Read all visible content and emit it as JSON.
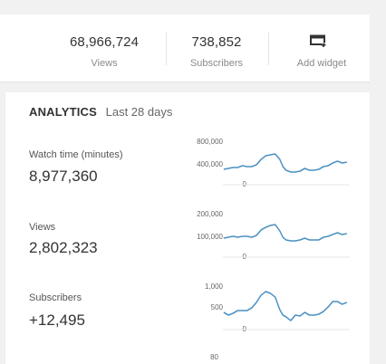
{
  "stats": {
    "views_value": "68,966,724",
    "views_label": "Views",
    "subscribers_value": "738,852",
    "subscribers_label": "Subscribers",
    "add_widget_label": "Add widget"
  },
  "analytics": {
    "title": "ANALYTICS",
    "period": "Last 28 days",
    "metrics": [
      {
        "label": "Watch time (minutes)",
        "value": "8,977,360",
        "ticks": [
          "800,000",
          "400,000",
          "0"
        ]
      },
      {
        "label": "Views",
        "value": "2,802,323",
        "ticks": [
          "200,000",
          "100,000",
          "0"
        ]
      },
      {
        "label": "Subscribers",
        "value": "+12,495",
        "ticks": [
          "1,000",
          "500",
          "0"
        ]
      },
      {
        "ticks": [
          "80"
        ]
      }
    ]
  },
  "colors": {
    "line": "#4a90c2",
    "background": "#f1f1f1",
    "card": "#ffffff"
  },
  "icons": {
    "add_widget": "add-widget-icon"
  }
}
